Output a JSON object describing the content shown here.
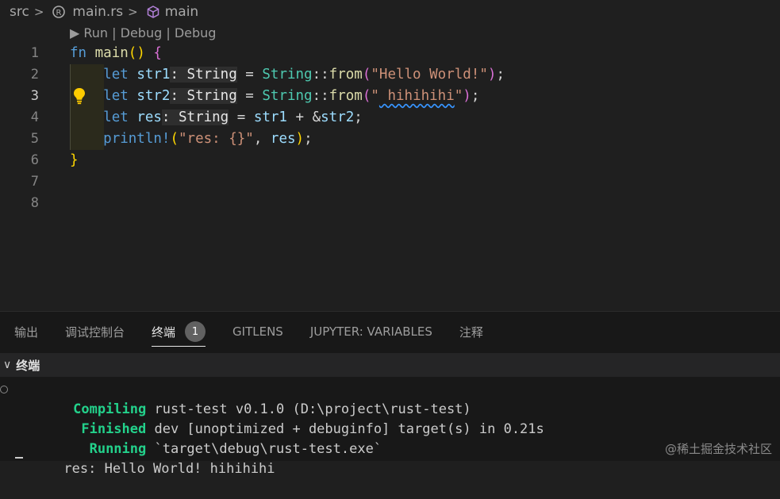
{
  "breadcrumb": {
    "folder": "src",
    "file": "main.rs",
    "symbol": "main",
    "icons": [
      "chevron-right-icon",
      "rust-icon",
      "cube-icon"
    ]
  },
  "editor": {
    "codelens": "▶ Run | Debug | Debug",
    "line_numbers": [
      "1",
      "2",
      "3",
      "4",
      "5",
      "6",
      "7",
      "8"
    ],
    "active_line": "3",
    "lines": {
      "l1": {
        "kw": "fn",
        "fname": "main",
        "parens": "()",
        "brace": "{"
      },
      "l2": {
        "kw": "let",
        "var": "str1",
        "hint": ": String",
        "eq": " = ",
        "ty": "String",
        "sep": "::",
        "fn": "from",
        "po": "(",
        "str": "\"Hello World!\"",
        "pc": ")",
        "end": ";"
      },
      "l3": {
        "kw": "let",
        "var": "str2",
        "hint": ": String",
        "eq": " = ",
        "ty": "String",
        "sep": "::",
        "fn": "from",
        "po": "(",
        "str_a": "\"",
        "str_b": " hihihihi",
        "str_c": "\"",
        "pc": ")",
        "end": ";"
      },
      "l4": {
        "kw": "let",
        "var": "res",
        "hint": ": String",
        "eq": " = ",
        "var2": "str1",
        "op": " + &",
        "var3": "str2",
        "end": ";"
      },
      "l5": {
        "mac": "println!",
        "po": "(",
        "str": "\"res: {}\"",
        "comma": ", ",
        "var": "res",
        "pc": ")",
        "end": ";"
      },
      "l6": {
        "brace": "}"
      }
    }
  },
  "panel": {
    "tabs": [
      "输出",
      "调试控制台",
      "终端",
      "GITLENS",
      "JUPYTER: VARIABLES",
      "注释"
    ],
    "active_tab": "终端",
    "terminal_badge": "1",
    "section_title": "终端",
    "terminal": {
      "l1_label": "   Compiling",
      "l1_text": " rust-test v0.1.0 (D:\\project\\rust-test)",
      "l2_label": "    Finished",
      "l2_text": " dev [unoptimized + debuginfo] target(s) in 0.21s",
      "l3_label": "     Running",
      "l3_text": " `target\\debug\\rust-test.exe`",
      "l4_text": "res: Hello World! hihihihi"
    }
  },
  "watermark": "@稀土掘金技术社区",
  "colors": {
    "background": "#1f1f1f",
    "keyword": "#569cd6",
    "function": "#dcdcaa",
    "type": "#4ec9b0",
    "variable": "#9cdcfe",
    "string": "#ce9178",
    "terminal_green": "#23d18b"
  }
}
